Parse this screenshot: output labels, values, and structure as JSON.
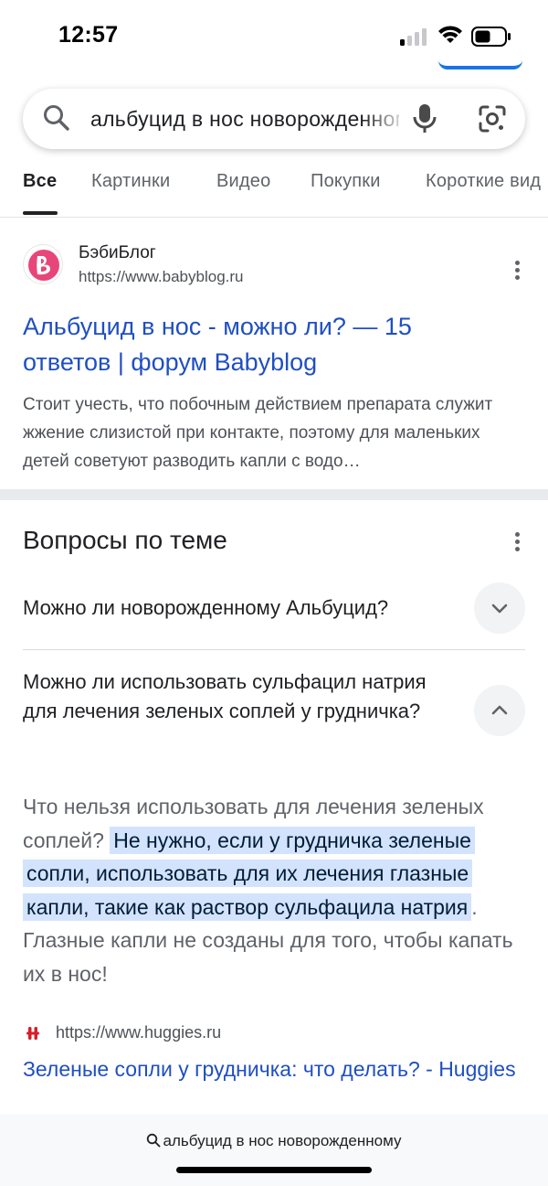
{
  "status_bar": {
    "time": "12:57",
    "signal_icon": "cellular-signal-icon",
    "wifi_icon": "wifi-icon",
    "battery_icon": "battery-icon"
  },
  "search": {
    "query": "альбуцид в нос новорожденному",
    "search_icon": "search-icon",
    "mic_icon": "microphone-icon",
    "lens_icon": "google-lens-icon"
  },
  "tabs": [
    {
      "label": "Все",
      "active": true
    },
    {
      "label": "Картинки"
    },
    {
      "label": "Видео"
    },
    {
      "label": "Покупки"
    },
    {
      "label": "Короткие вид"
    }
  ],
  "result1": {
    "site_name": "БэбиБлог",
    "url": "https://www.babyblog.ru",
    "title": "Альбуцид в нос - можно ли? — 15 ответов | форум Babyblog",
    "snippet": "Стоит учесть, что побочным действием препарата служит жжение слизистой при контакте, поэтому для маленьких детей советуют разводить капли с водо…"
  },
  "questions": {
    "heading": "Вопросы по теме",
    "items": [
      {
        "question": "Можно ли новорожденному Альбуцид?",
        "expanded": false
      },
      {
        "question": "Можно ли использовать сульфацил натрия для лечения зеленых соплей у грудничка?",
        "expanded": true
      }
    ],
    "answer": {
      "before": "Что нельзя использовать для лечения зеленых соплей?",
      "highlight": "Не нужно, если у грудничка зеленые сопли, использовать для их лечения глазные капли, такие как раствор сульфацила натрия",
      "after": ". Глазные капли не созданы для того, чтобы капать их в нос!"
    },
    "source": {
      "url": "https://www.huggies.ru",
      "title": "Зеленые сопли у грудничка: что делать? - Huggies"
    }
  },
  "bottom_bar": {
    "query": "альбуцид в нос новорожденному"
  },
  "colors": {
    "link": "#1f4fc1",
    "highlight": "#d3e3fd",
    "accent": "#1a73e8",
    "babyblog_pink": "#e8457a",
    "huggies_red": "#d4202a"
  }
}
